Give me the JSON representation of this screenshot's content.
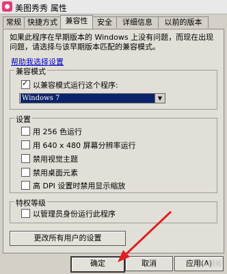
{
  "window": {
    "title": "美图秀秀 属性"
  },
  "tabs": [
    "常规",
    "快捷方式",
    "兼容性",
    "安全",
    "详细信息",
    "以前的版本"
  ],
  "intro": "如果此程序在早期版本的 Windows 上没有问题，而现在出现问题，请选择与该早期版本匹配的兼容模式。",
  "help_link": "帮助我选择设置",
  "compat_mode": {
    "group_label": "兼容模式",
    "checkbox_label": "以兼容模式运行这个程序:",
    "selected_os": "Windows 7"
  },
  "settings": {
    "group_label": "设置",
    "options": [
      "用 256 色运行",
      "用 640 x 480 屏幕分辨率运行",
      "禁用视觉主题",
      "禁用桌面元素",
      "高 DPI 设置时禁用显示缩放"
    ]
  },
  "privilege": {
    "group_label": "特权等级",
    "option": "以管理员身份运行此程序"
  },
  "all_users_button": "更改所有用户的设置",
  "buttons": {
    "ok": "确定",
    "cancel": "取消",
    "apply": "应用(A)"
  },
  "watermark": "Bai经验"
}
